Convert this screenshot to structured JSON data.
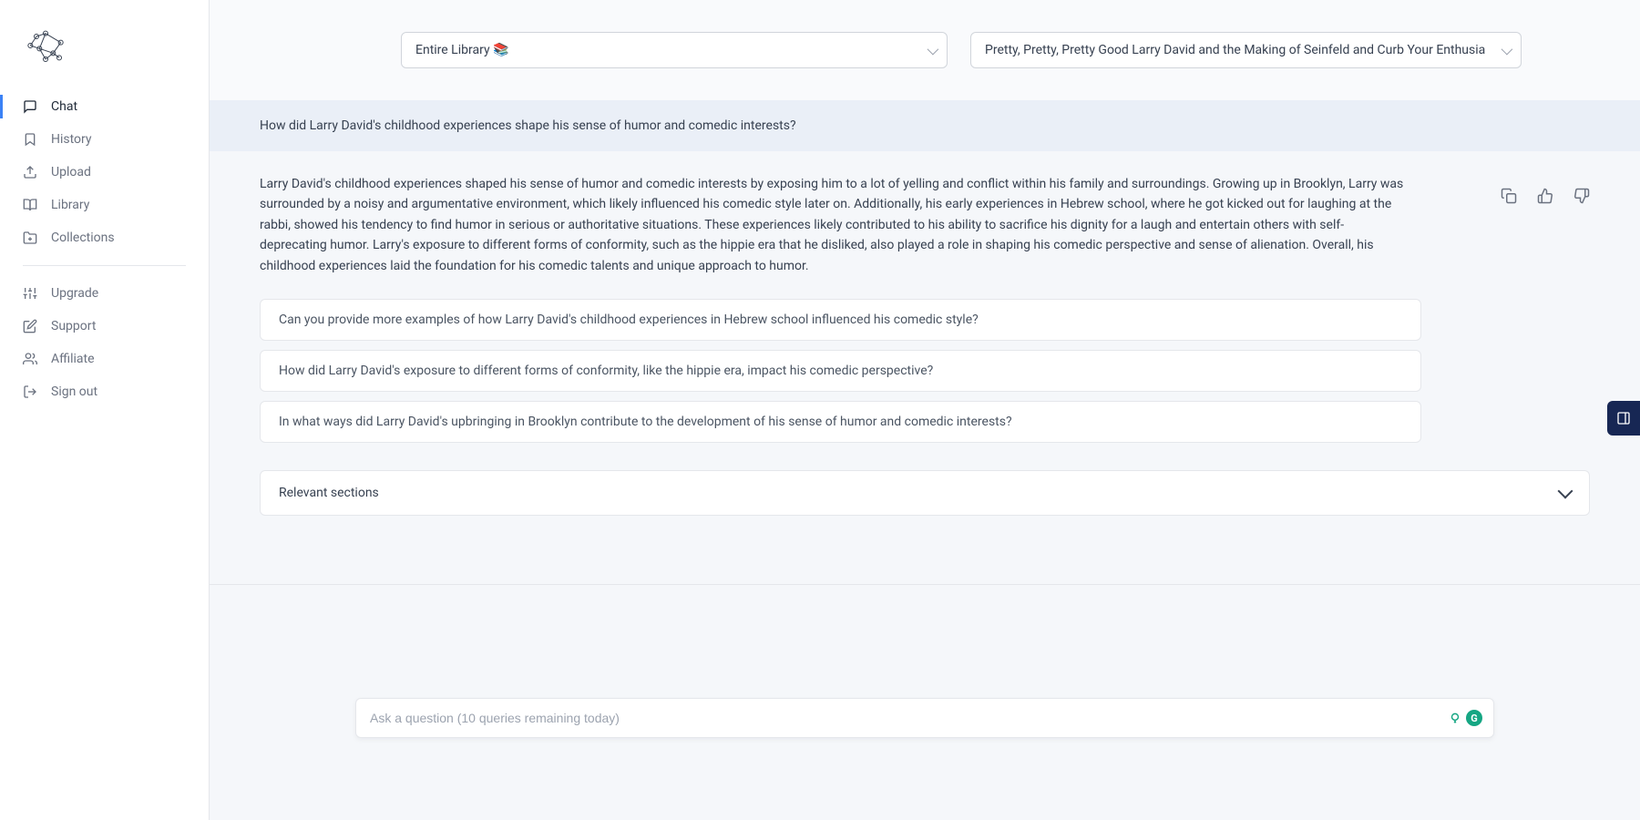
{
  "sidebar": {
    "items": [
      {
        "label": "Chat",
        "icon": "chat"
      },
      {
        "label": "History",
        "icon": "bookmark"
      },
      {
        "label": "Upload",
        "icon": "upload"
      },
      {
        "label": "Library",
        "icon": "library"
      },
      {
        "label": "Collections",
        "icon": "collections"
      }
    ],
    "items2": [
      {
        "label": "Upgrade",
        "icon": "upgrade"
      },
      {
        "label": "Support",
        "icon": "support"
      },
      {
        "label": "Affiliate",
        "icon": "affiliate"
      },
      {
        "label": "Sign out",
        "icon": "signout"
      }
    ]
  },
  "topbar": {
    "library_selector": "Entire Library 📚",
    "book_selector": "Pretty, Pretty, Pretty Good Larry David and the Making of Seinfeld and Curb Your Enthusia"
  },
  "question": "How did Larry David's childhood experiences shape his sense of humor and comedic interests?",
  "answer": "Larry David's childhood experiences shaped his sense of humor and comedic interests by exposing him to a lot of yelling and conflict within his family and surroundings. Growing up in Brooklyn, Larry was surrounded by a noisy and argumentative environment, which likely influenced his comedic style later on. Additionally, his early experiences in Hebrew school, where he got kicked out for laughing at the rabbi, showed his tendency to find humor in serious or authoritative situations. These experiences likely contributed to his ability to sacrifice his dignity for a laugh and entertain others with self-deprecating humor. Larry's exposure to different forms of conformity, such as the hippie era that he disliked, also played a role in shaping his comedic perspective and sense of alienation. Overall, his childhood experiences laid the foundation for his comedic talents and unique approach to humor.",
  "suggestions": [
    "Can you provide more examples of how Larry David's childhood experiences in Hebrew school influenced his comedic style?",
    "How did Larry David's exposure to different forms of conformity, like the hippie era, impact his comedic perspective?",
    "In what ways did Larry David's upbringing in Brooklyn contribute to the development of his sense of humor and comedic interests?"
  ],
  "relevant_sections_label": "Relevant sections",
  "input_placeholder": "Ask a question (10 queries remaining today)",
  "grammar_letter": "G"
}
